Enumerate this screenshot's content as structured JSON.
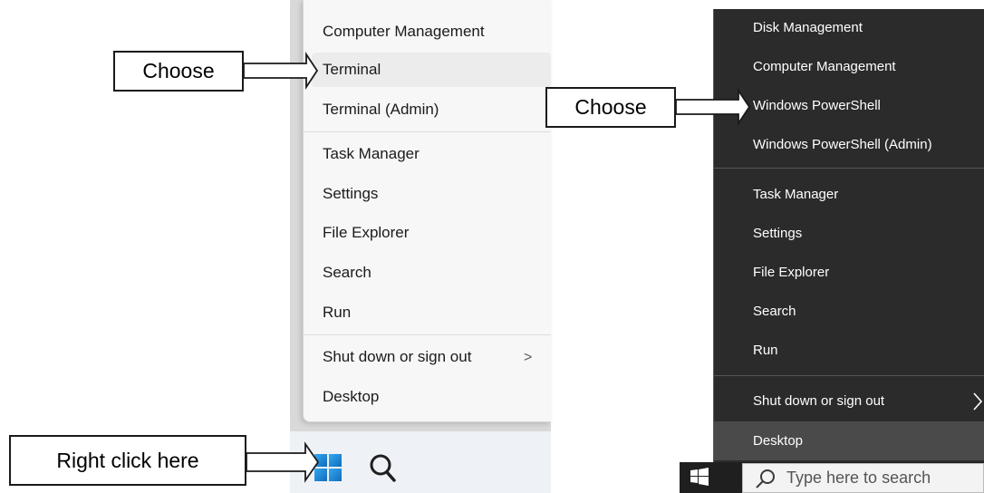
{
  "left_menu": {
    "items": [
      {
        "label": "Computer Management"
      },
      {
        "label": "Terminal"
      },
      {
        "label": "Terminal (Admin)"
      },
      {
        "label": "Task Manager"
      },
      {
        "label": "Settings"
      },
      {
        "label": "File Explorer"
      },
      {
        "label": "Search"
      },
      {
        "label": "Run"
      },
      {
        "label": "Shut down or sign out",
        "chevron": ">"
      },
      {
        "label": "Desktop"
      }
    ]
  },
  "right_menu": {
    "items": [
      {
        "label": "Disk Management"
      },
      {
        "label": "Computer Management"
      },
      {
        "label": "Windows PowerShell"
      },
      {
        "label": "Windows PowerShell (Admin)"
      },
      {
        "label": "Task Manager"
      },
      {
        "label": "Settings"
      },
      {
        "label": "File Explorer"
      },
      {
        "label": "Search"
      },
      {
        "label": "Run"
      },
      {
        "label": "Shut down or sign out"
      },
      {
        "label": "Desktop"
      }
    ],
    "search_placeholder": "Type here to search"
  },
  "callouts": {
    "choose_left": "Choose",
    "choose_right": "Choose",
    "right_click": "Right click here"
  },
  "icons": [
    "windows-logo-icon",
    "search-icon",
    "chevron-right-icon",
    "windows10-logo-icon"
  ],
  "colors": {
    "windows_blue": "#0f6cbd",
    "dark_menu": "#2b2b2b",
    "light_menu": "#f7f7f7"
  }
}
